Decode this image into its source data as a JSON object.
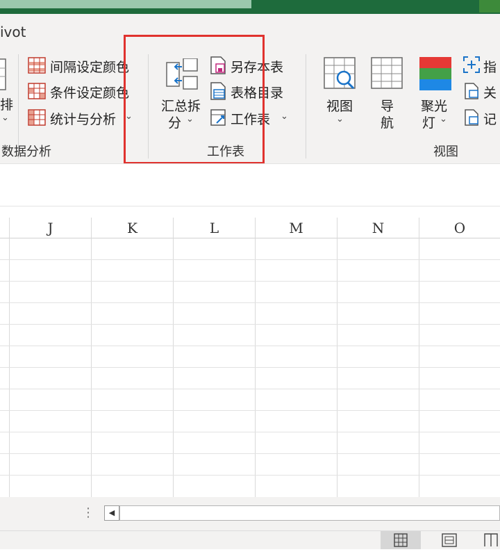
{
  "menu": {
    "active_tab": "ivot"
  },
  "ribbon": {
    "left_group": {
      "partial_label_top": "排",
      "partial_chevron": "⌄",
      "group_label": "数据分析",
      "items": [
        {
          "label": "间隔设定颜色"
        },
        {
          "label": "条件设定颜色"
        },
        {
          "label": "统计与分析",
          "chevron": "⌄"
        }
      ]
    },
    "worksheet_group": {
      "group_label": "工作表",
      "big_button": {
        "line1": "汇总拆",
        "line2": "分",
        "chevron": "⌄"
      },
      "items": [
        {
          "label": "另存本表"
        },
        {
          "label": "表格目录"
        },
        {
          "label": "工作表",
          "chevron": "⌄"
        }
      ]
    },
    "view_group": {
      "group_label": "视图",
      "buttons": [
        {
          "line1": "视图",
          "line2": "⌄"
        },
        {
          "line1": "导",
          "line2": "航"
        },
        {
          "line1": "聚光",
          "line2": "灯",
          "chevron": "⌄"
        }
      ],
      "right_items": [
        {
          "label": "指"
        },
        {
          "label": "关"
        },
        {
          "label": "记"
        }
      ]
    }
  },
  "sheet": {
    "columns": [
      "J",
      "K",
      "L",
      "M",
      "N",
      "O"
    ]
  },
  "scroll": {
    "dots": "⋮",
    "left_arrow": "◀"
  },
  "colors": {
    "accent_green": "#1e6b3c",
    "highlight_red": "#e0322e",
    "ribbon_bg": "#f3f2f1"
  }
}
